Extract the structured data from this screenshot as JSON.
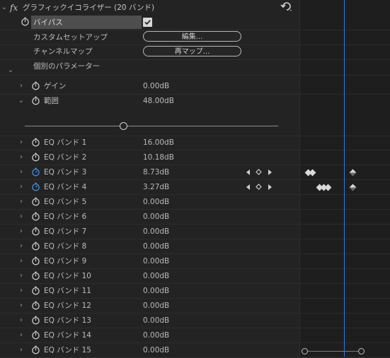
{
  "header": {
    "fx_label": "fx",
    "effect_name": "グラフィックイコライザー (20 バンド)",
    "reset_icon": "reset-icon"
  },
  "bypass": {
    "label": "バイパス",
    "checked": true
  },
  "custom_setup": {
    "label": "カスタムセットアップ",
    "button": "編集..."
  },
  "channel_map": {
    "label": "チャンネルマップ",
    "button": "再マップ..."
  },
  "individual_params": {
    "label": "個別のパラメーター"
  },
  "gain": {
    "label": "ゲイン",
    "value": "0.00dB"
  },
  "range": {
    "label": "範囲",
    "value": "48.00dB",
    "slider_fraction": 0.39
  },
  "bands": [
    {
      "label": "EQ バンド 1",
      "value": "16.00dB",
      "animated": false
    },
    {
      "label": "EQ バンド 2",
      "value": "10.18dB",
      "animated": false
    },
    {
      "label": "EQ バンド 3",
      "value": "8.73dB",
      "animated": true
    },
    {
      "label": "EQ バンド 4",
      "value": "3.27dB",
      "animated": true
    },
    {
      "label": "EQ バンド 5",
      "value": "0.00dB",
      "animated": false
    },
    {
      "label": "EQ バンド 6",
      "value": "0.00dB",
      "animated": false
    },
    {
      "label": "EQ バンド 7",
      "value": "0.00dB",
      "animated": false
    },
    {
      "label": "EQ バンド 8",
      "value": "0.00dB",
      "animated": false
    },
    {
      "label": "EQ バンド 9",
      "value": "0.00dB",
      "animated": false
    },
    {
      "label": "EQ バンド 10",
      "value": "0.00dB",
      "animated": false
    },
    {
      "label": "EQ バンド 11",
      "value": "0.00dB",
      "animated": false
    },
    {
      "label": "EQ バンド 12",
      "value": "0.00dB",
      "animated": false
    },
    {
      "label": "EQ バンド 13",
      "value": "0.00dB",
      "animated": false
    },
    {
      "label": "EQ バンド 14",
      "value": "0.00dB",
      "animated": false
    },
    {
      "label": "EQ バンド 15",
      "value": "0.00dB",
      "animated": false
    }
  ],
  "colors": {
    "accent": "#3a78d6",
    "background": "#232323",
    "text": "#bdbdbd",
    "value_text": "#b9b9b9"
  }
}
